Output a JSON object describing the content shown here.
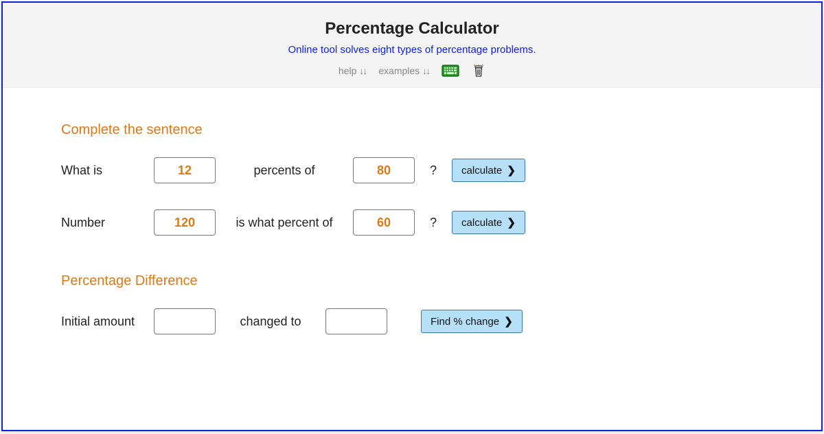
{
  "header": {
    "title": "Percentage Calculator",
    "subtitle": "Online tool solves eight types of percentage problems.",
    "help_label": "help",
    "examples_label": "examples",
    "down_arrows": "↓↓"
  },
  "section1": {
    "title": "Complete the sentence",
    "row1": {
      "lead": "What is",
      "value1": "12",
      "mid": "percents of",
      "value2": "80",
      "q": "?",
      "button": "calculate"
    },
    "row2": {
      "lead": "Number",
      "value1": "120",
      "mid": "is what percent of",
      "value2": "60",
      "q": "?",
      "button": "calculate"
    }
  },
  "section2": {
    "title": "Percentage Difference",
    "row1": {
      "lead": "Initial amount",
      "value1": "",
      "mid": "changed to",
      "value2": "",
      "button": "Find % change"
    }
  }
}
